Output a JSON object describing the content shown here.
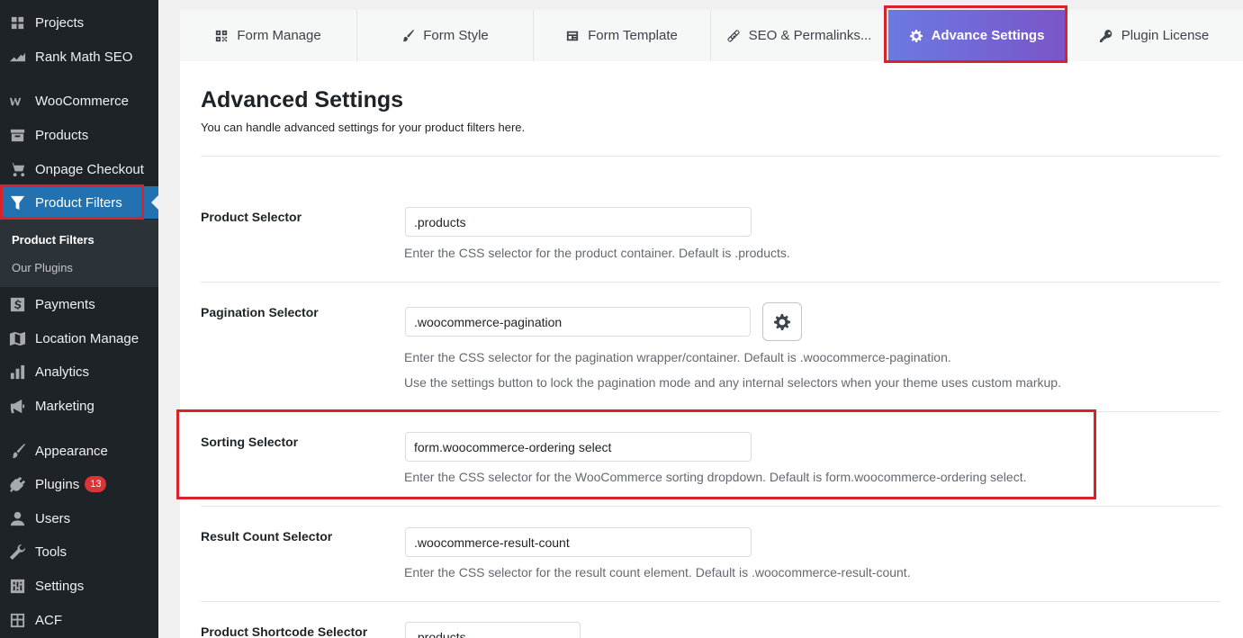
{
  "sidebar": {
    "items": [
      {
        "label": "Projects",
        "icon": "projects-icon"
      },
      {
        "label": "Rank Math SEO",
        "icon": "rank-math-icon"
      },
      {
        "label": "WooCommerce",
        "icon": "woocommerce-icon"
      },
      {
        "label": "Products",
        "icon": "archive-icon"
      },
      {
        "label": "Onpage Checkout",
        "icon": "cart-icon"
      },
      {
        "label": "Product Filters",
        "icon": "filter-icon"
      },
      {
        "label": "Payments",
        "icon": "dollar-icon"
      },
      {
        "label": "Location Manage",
        "icon": "map-icon"
      },
      {
        "label": "Analytics",
        "icon": "bar-chart-icon"
      },
      {
        "label": "Marketing",
        "icon": "megaphone-icon"
      },
      {
        "label": "Appearance",
        "icon": "paint-brush-icon"
      },
      {
        "label": "Plugins",
        "icon": "plugin-icon",
        "badge": "13"
      },
      {
        "label": "Users",
        "icon": "user-icon"
      },
      {
        "label": "Tools",
        "icon": "wrench-icon"
      },
      {
        "label": "Settings",
        "icon": "settings-sliders-icon"
      },
      {
        "label": "ACF",
        "icon": "acf-icon"
      }
    ],
    "submenu": {
      "active": "Product Filters",
      "other": "Our Plugins"
    }
  },
  "tabs": [
    {
      "label": "Form Manage",
      "icon": "grid-icon"
    },
    {
      "label": "Form Style",
      "icon": "brush-icon"
    },
    {
      "label": "Form Template",
      "icon": "template-icon"
    },
    {
      "label": "SEO & Permalinks...",
      "icon": "link-icon"
    },
    {
      "label": "Advance Settings",
      "icon": "gear-icon",
      "active": true
    },
    {
      "label": "Plugin License",
      "icon": "key-icon"
    }
  ],
  "page": {
    "title": "Advanced Settings",
    "description": "You can handle advanced settings for your product filters here."
  },
  "fields": {
    "product_selector": {
      "label": "Product Selector",
      "value": ".products",
      "help": "Enter the CSS selector for the product container. Default is .products."
    },
    "pagination_selector": {
      "label": "Pagination Selector",
      "value": ".woocommerce-pagination",
      "help": "Enter the CSS selector for the pagination wrapper/container. Default is .woocommerce-pagination.",
      "help2": "Use the settings button to lock the pagination mode and any internal selectors when your theme uses custom markup."
    },
    "sorting_selector": {
      "label": "Sorting Selector",
      "value": "form.woocommerce-ordering select",
      "help": "Enter the CSS selector for the WooCommerce sorting dropdown. Default is form.woocommerce-ordering select."
    },
    "result_count_selector": {
      "label": "Result Count Selector",
      "value": ".woocommerce-result-count",
      "help": "Enter the CSS selector for the result count element. Default is .woocommerce-result-count."
    },
    "shortcode_selector": {
      "label": "Product Shortcode Selector",
      "value": ".products"
    }
  },
  "colors": {
    "sidebar_bg": "#1d2327",
    "wp_blue": "#2271b1",
    "highlight_red": "#d9232a",
    "tab_gradient_start": "#6c7ae0",
    "tab_gradient_end": "#7a55c8"
  }
}
